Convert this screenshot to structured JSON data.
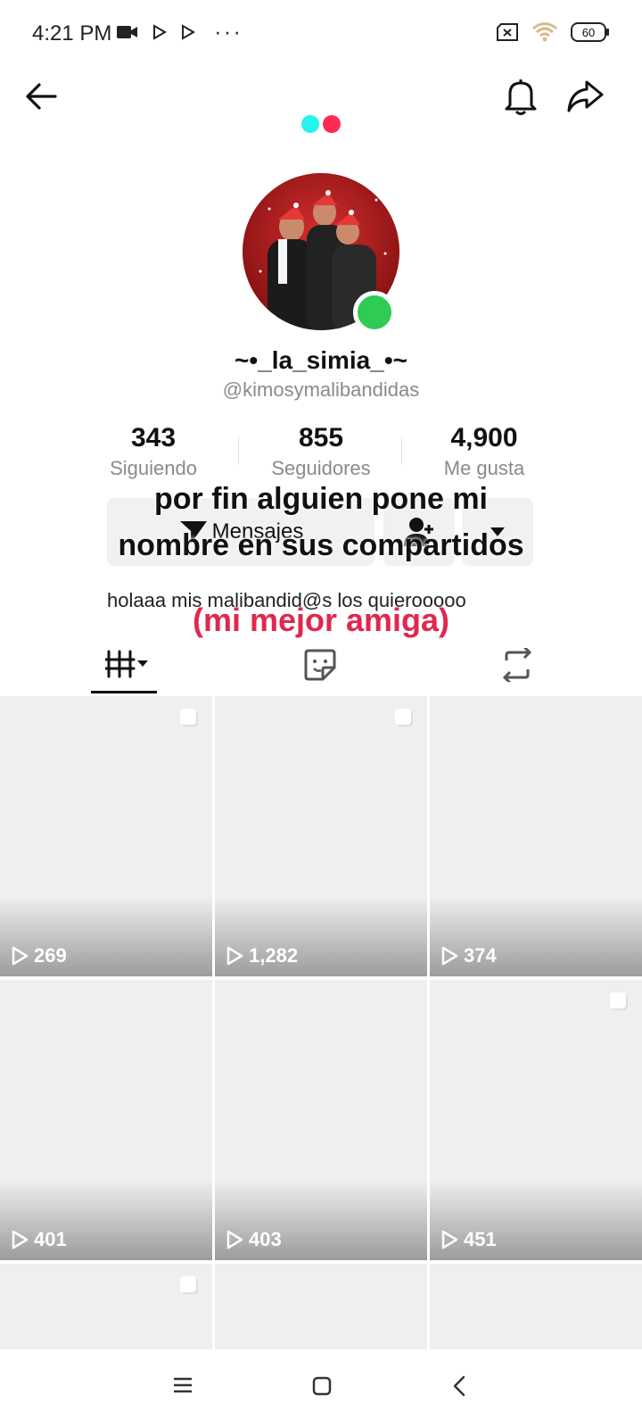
{
  "status_bar": {
    "time": "4:21 PM",
    "battery": "60"
  },
  "profile": {
    "display_name": "~•_la_simia_•~",
    "handle": "@kimosymalibandidas",
    "bio": "holaaa mis malibandid@s los quierooooo"
  },
  "stats": [
    {
      "value": "343",
      "label": "Siguiendo"
    },
    {
      "value": "855",
      "label": "Seguidores"
    },
    {
      "value": "4,900",
      "label": "Me gusta"
    }
  ],
  "actions": {
    "messages_label": "Mensajes"
  },
  "overlay": {
    "line1": "por fin alguien pone mi",
    "line2": "nombre en sus compartidos",
    "line3": "(mi mejor amiga)"
  },
  "videos": [
    {
      "views": "269",
      "pinned": true
    },
    {
      "views": "1,282",
      "pinned": true
    },
    {
      "views": "374",
      "pinned": false
    },
    {
      "views": "401",
      "pinned": false
    },
    {
      "views": "403",
      "pinned": false
    },
    {
      "views": "451",
      "pinned": true
    },
    {
      "views": "",
      "pinned": true
    },
    {
      "views": "",
      "pinned": false
    },
    {
      "views": "",
      "pinned": false
    }
  ],
  "colors": {
    "accent_pink": "#e0284f",
    "online": "#2ecc55",
    "logo_cyan": "#25f4ee",
    "logo_red": "#fe2c55"
  },
  "icons": [
    "back-arrow-icon",
    "bell-icon",
    "share-icon",
    "send-icon",
    "add-friend-icon",
    "chevron-down-icon",
    "grid-icon",
    "sticker-icon",
    "repost-icon",
    "play-icon",
    "menu-icon",
    "home-square-icon",
    "back-chevron-icon"
  ]
}
